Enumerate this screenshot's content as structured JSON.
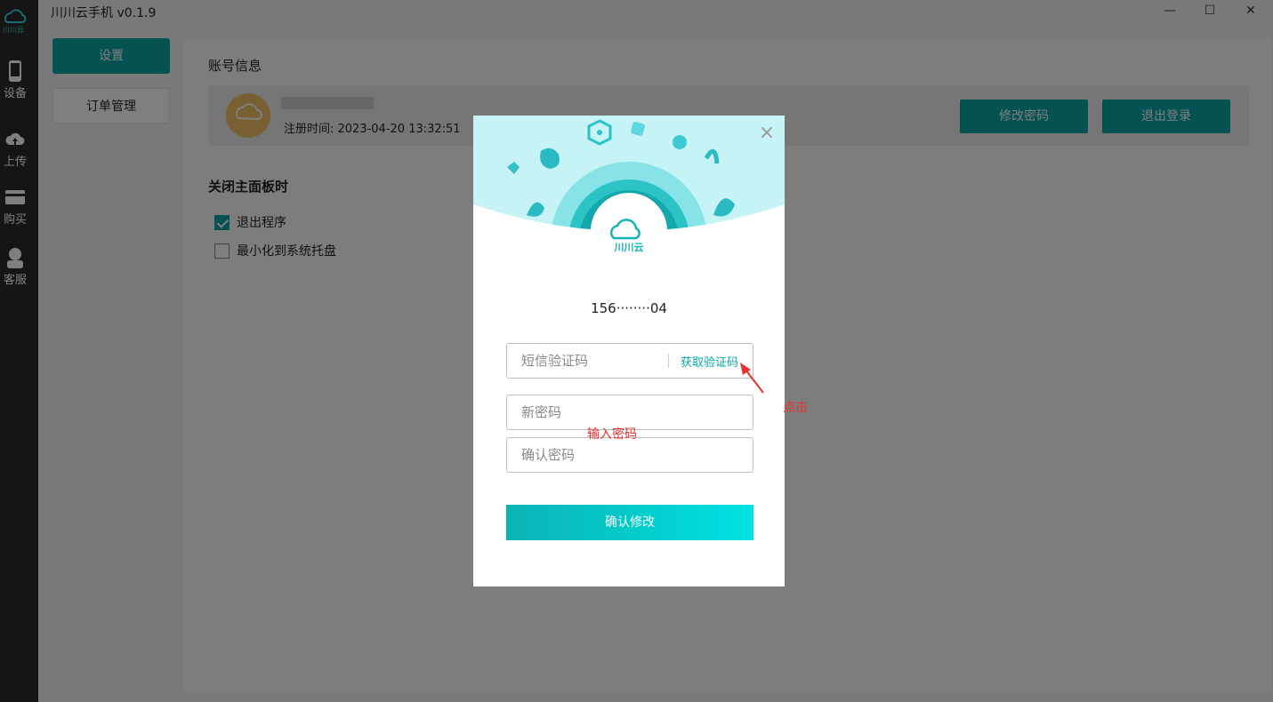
{
  "app": {
    "title": "川川云手机 v0.1.9",
    "logo_text": "川川云",
    "window_controls": {
      "minimize": "—",
      "maximize": "☐",
      "close": "✕"
    }
  },
  "sidebar": {
    "items": [
      {
        "label": "设备",
        "icon": "phone-icon"
      },
      {
        "label": "上传",
        "icon": "cloud-upload-icon"
      },
      {
        "label": "购买",
        "icon": "card-icon"
      },
      {
        "label": "客服",
        "icon": "headset-icon"
      }
    ]
  },
  "nav": {
    "settings": "设置",
    "orders": "订单管理"
  },
  "account": {
    "section_title": "账号信息",
    "register_time": "注册时间: 2023-04-20 13:32:51",
    "change_password": "修改密码",
    "logout": "退出登录"
  },
  "close_behavior": {
    "section_title": "关闭主面板时",
    "options": [
      {
        "label": "退出程序",
        "checked": true
      },
      {
        "label": "最小化到系统托盘",
        "checked": false
      }
    ]
  },
  "dialog": {
    "logo_text": "川川云",
    "close": "×",
    "phone": "156········04",
    "sms_placeholder": "短信验证码",
    "get_code": "获取验证码",
    "new_password_placeholder": "新密码",
    "confirm_password_placeholder": "确认密码",
    "confirm_button": "确认修改"
  },
  "annotations": {
    "click_hint": "点击",
    "input_hint": "输入密码"
  },
  "colors": {
    "accent": "#0aa4a4",
    "annotation": "#e8312e"
  }
}
